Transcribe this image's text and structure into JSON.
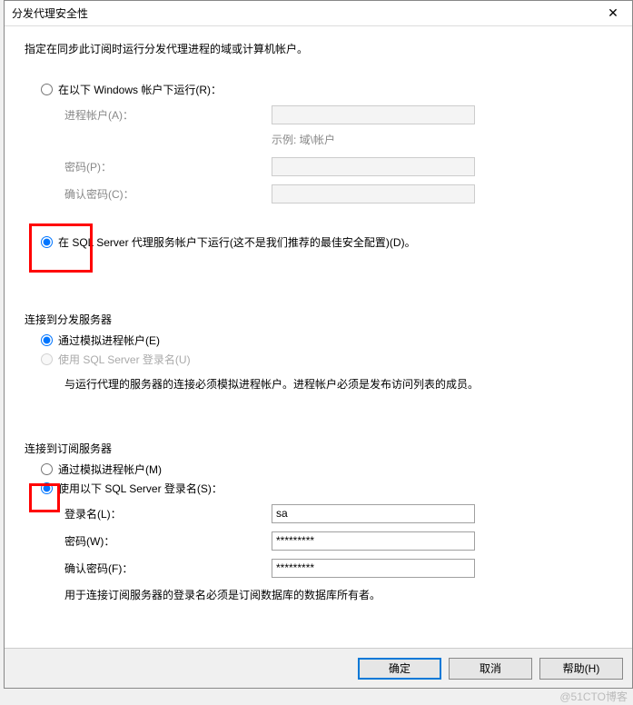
{
  "title": "分发代理安全性",
  "instruction": "指定在同步此订阅时运行分发代理进程的域或计算机帐户。",
  "section1": {
    "radio_windows": "在以下 Windows 帐户下运行(R)：",
    "process_account_label": "进程帐户(A)：",
    "hint": "示例: 域\\帐户",
    "password_label": "密码(P)：",
    "confirm_password_label": "确认密码(C)：",
    "radio_sqlserver": "在 SQL Server 代理服务帐户下运行(这不是我们推荐的最佳安全配置)(D)。"
  },
  "section2": {
    "header": "连接到分发服务器",
    "radio_impersonate": "通过模拟进程帐户(E)",
    "radio_sqllogin": "使用 SQL Server 登录名(U)",
    "note": "与运行代理的服务器的连接必须模拟进程帐户。进程帐户必须是发布访问列表的成员。"
  },
  "section3": {
    "header": "连接到订阅服务器",
    "radio_impersonate": "通过模拟进程帐户(M)",
    "radio_sqllogin": "使用以下 SQL Server 登录名(S)：",
    "login_label": "登录名(L)：",
    "login_value": "sa",
    "password_label": "密码(W)：",
    "password_value": "*********",
    "confirm_label": "确认密码(F)：",
    "confirm_value": "*********",
    "note": "用于连接订阅服务器的登录名必须是订阅数据库的数据库所有者。"
  },
  "buttons": {
    "ok": "确定",
    "cancel": "取消",
    "help": "帮助(H)"
  },
  "watermark": "@51CTO博客"
}
